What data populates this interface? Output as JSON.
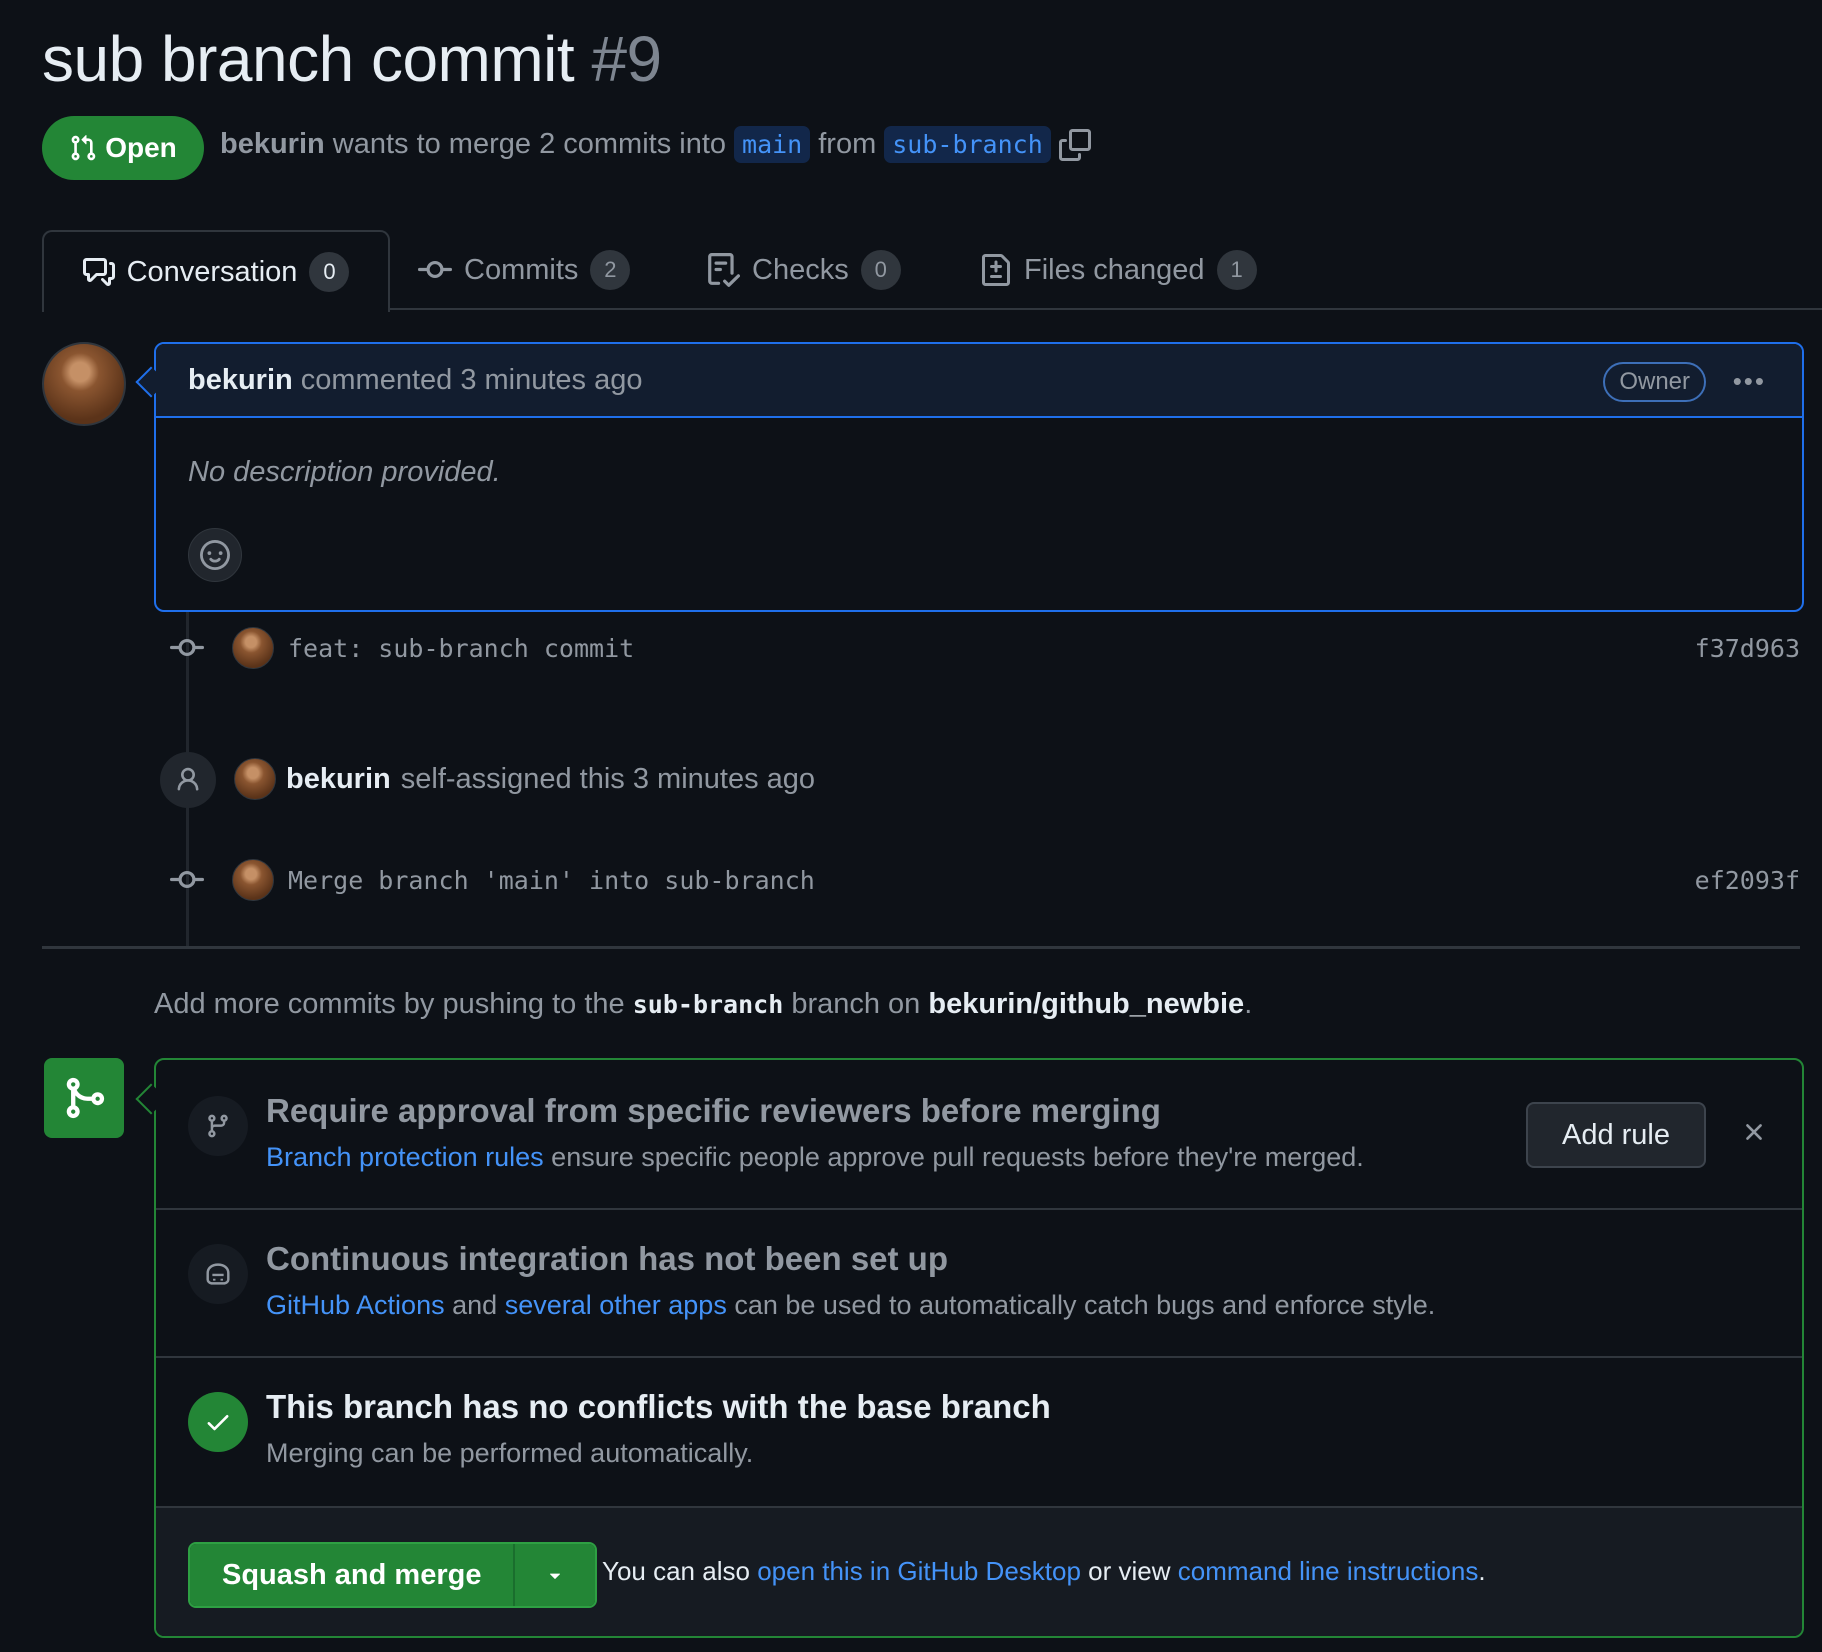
{
  "pr": {
    "title": "sub branch commit",
    "number": "#9",
    "state": "Open",
    "author": "bekurin",
    "merge_text": "wants to merge 2 commits into",
    "base_branch": "main",
    "from_text": "from",
    "head_branch": "sub-branch"
  },
  "tabs": [
    {
      "label": "Conversation",
      "count": "0"
    },
    {
      "label": "Commits",
      "count": "2"
    },
    {
      "label": "Checks",
      "count": "0"
    },
    {
      "label": "Files changed",
      "count": "1"
    }
  ],
  "comment": {
    "author": "bekurin",
    "action": "commented 3 minutes ago",
    "badge": "Owner",
    "body": "No description provided."
  },
  "timeline": {
    "commit1": {
      "message": "feat: sub-branch commit",
      "sha": "f37d963"
    },
    "event": {
      "actor": "bekurin",
      "text": "self-assigned this 3 minutes ago"
    },
    "commit2": {
      "message": "Merge branch 'main' into sub-branch",
      "sha": "ef2093f"
    }
  },
  "push_hint": {
    "prefix": "Add more commits by pushing to the",
    "branch": "sub-branch",
    "middle": "branch on",
    "repo": "bekurin/github_newbie",
    "suffix": "."
  },
  "merge": {
    "reviewers": {
      "title": "Require approval from specific reviewers before merging",
      "link": "Branch protection rules",
      "text": "ensure specific people approve pull requests before they're merged.",
      "button": "Add rule"
    },
    "ci": {
      "title": "Continuous integration has not been set up",
      "link1": "GitHub Actions",
      "and": "and",
      "link2": "several other apps",
      "text": "can be used to automatically catch bugs and enforce style."
    },
    "conflicts": {
      "title": "This branch has no conflicts with the base branch",
      "text": "Merging can be performed automatically."
    },
    "footer": {
      "button": "Squash and merge",
      "also": "You can also",
      "link1": "open this in GitHub Desktop",
      "or": "or view",
      "link2": "command line instructions",
      "end": "."
    }
  },
  "colors": {
    "accent": "#4493f8",
    "success": "#238636",
    "bg": "#0d1117"
  }
}
